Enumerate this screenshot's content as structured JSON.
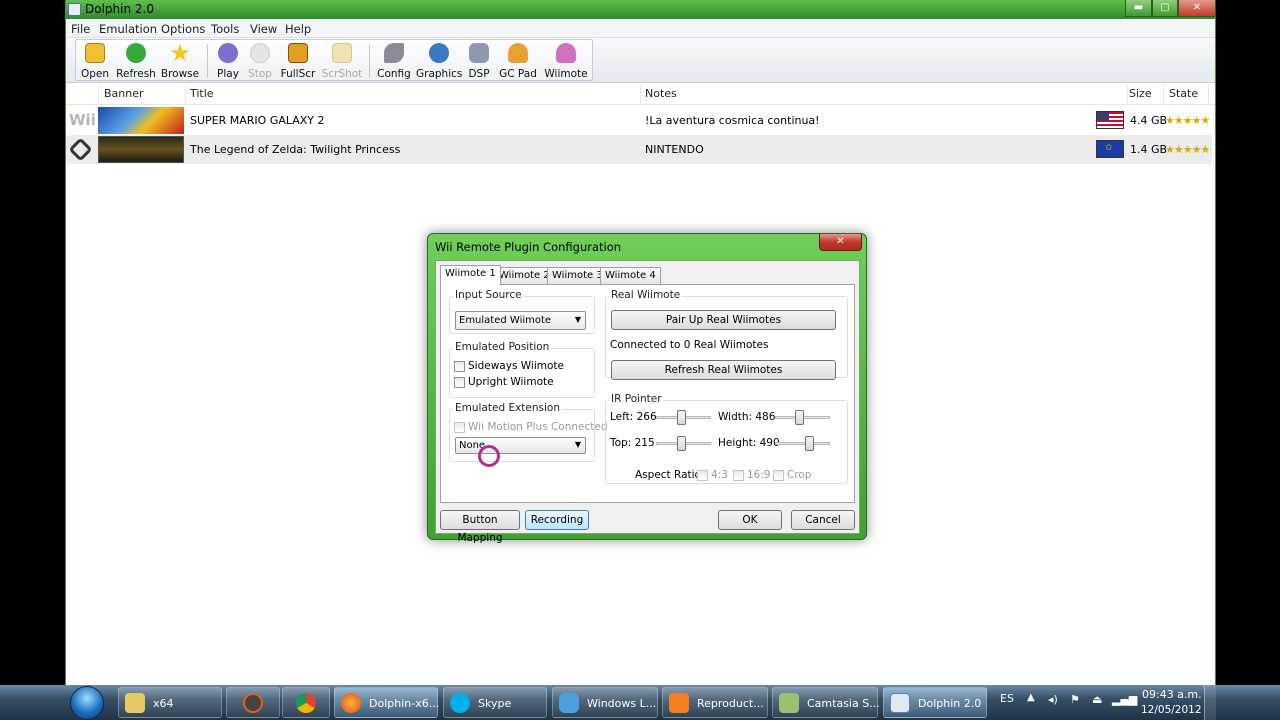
{
  "window": {
    "title": "Dolphin 2.0",
    "controls": {
      "minimize": "▬",
      "maximize": "▢",
      "close": "✕"
    }
  },
  "menu": [
    "File",
    "Emulation",
    "Options",
    "Tools",
    "View",
    "Help"
  ],
  "toolbar": [
    {
      "label": "Open",
      "icon": "folder-icon",
      "color": "#f0c030",
      "enabled": true
    },
    {
      "label": "Refresh",
      "icon": "refresh-icon",
      "color": "#3aa83a",
      "enabled": true
    },
    {
      "label": "Browse",
      "icon": "star-icon",
      "color": "#f5c518",
      "enabled": true
    },
    {
      "label": "Play",
      "icon": "play-icon",
      "color": "#7b6fd0",
      "enabled": true
    },
    {
      "label": "Stop",
      "icon": "stop-icon",
      "color": "#d0d0d0",
      "enabled": false
    },
    {
      "label": "FullScr",
      "icon": "fullscreen-icon",
      "color": "#e0a020",
      "enabled": true
    },
    {
      "label": "ScrShot",
      "icon": "screenshot-icon",
      "color": "#e8d8a0",
      "enabled": false
    },
    {
      "label": "Config",
      "icon": "wrench-icon",
      "color": "#8a8a9a",
      "enabled": true
    },
    {
      "label": "Graphics",
      "icon": "graphics-icon",
      "color": "#3a7ac0",
      "enabled": true
    },
    {
      "label": "DSP",
      "icon": "speaker-icon",
      "color": "#9098b0",
      "enabled": true
    },
    {
      "label": "GC Pad",
      "icon": "gcpad-icon",
      "color": "#e8a030",
      "enabled": true
    },
    {
      "label": "Wiimote",
      "icon": "wiimote-icon",
      "color": "#d070c0",
      "enabled": true
    }
  ],
  "columns": {
    "banner": "Banner",
    "title": "Title",
    "notes": "Notes",
    "size": "Size",
    "state": "State"
  },
  "games": [
    {
      "platform": "Wii",
      "title": "SUPER MARIO GALAXY 2",
      "notes": "!La aventura cosmica continua!",
      "size": "4.4 GB",
      "region": "usa-flag",
      "stars": "★★★★★"
    },
    {
      "platform": "GC",
      "title": "The Legend of Zelda: Twilight Princess",
      "notes": "NINTENDO",
      "size": "1.4 GB",
      "region": "eu-flag",
      "stars": "★★★★★"
    }
  ],
  "dialog": {
    "title": "Wii Remote Plugin Configuration",
    "tabs": [
      "Wiimote 1",
      "Wiimote 2",
      "Wiimote 3",
      "Wiimote 4"
    ],
    "input_source": {
      "label": "Input Source",
      "value": "Emulated Wiimote"
    },
    "emulated_position": {
      "label": "Emulated Position",
      "sideways": "Sideways Wiimote",
      "upright": "Upright Wiimote"
    },
    "emulated_extension": {
      "label": "Emulated Extension",
      "motion_plus": "Wii Motion Plus Connected",
      "value": "None"
    },
    "real_wiimote": {
      "label": "Real Wiimote",
      "pair_button": "Pair Up Real Wiimotes",
      "connected": "Connected to 0 Real Wiimotes",
      "refresh_button": "Refresh Real Wiimotes"
    },
    "ir_pointer": {
      "label": "IR Pointer",
      "left": "Left: 266",
      "width": "Width: 486",
      "top": "Top: 215",
      "height": "Height: 490",
      "left_value": 266,
      "width_value": 486,
      "top_value": 215,
      "height_value": 490,
      "aspect_label": "Aspect Ratio",
      "opt_43": "4:3",
      "opt_169": "16:9",
      "opt_crop": "Crop"
    },
    "buttons": {
      "mapping": "Button Mapping",
      "recording": "Recording",
      "ok": "OK",
      "cancel": "Cancel"
    }
  },
  "taskbar": {
    "items": [
      {
        "label": "x64",
        "icon": "folder-icon"
      },
      {
        "label": "",
        "icon": "app-icon"
      },
      {
        "label": "",
        "icon": "chrome-icon"
      },
      {
        "label": "Dolphin-x6...",
        "icon": "firefox-icon"
      },
      {
        "label": "Skype",
        "icon": "skype-icon"
      },
      {
        "label": "Windows L...",
        "icon": "windows-live-icon"
      },
      {
        "label": "Reproduct...",
        "icon": "media-player-icon"
      },
      {
        "label": "Camtasia S...",
        "icon": "camtasia-icon"
      },
      {
        "label": "Dolphin 2.0",
        "icon": "dolphin-icon"
      }
    ],
    "lang": "ES",
    "time": "09:43 a.m.",
    "date": "12/05/2012"
  }
}
